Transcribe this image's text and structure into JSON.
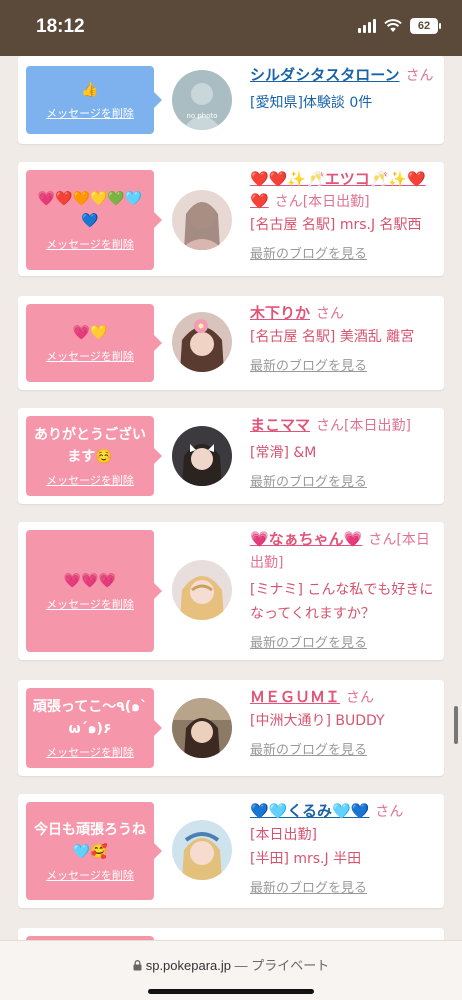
{
  "status_bar": {
    "time": "18:12",
    "battery": "62"
  },
  "browser": {
    "url": "sp.pokepara.jp",
    "separator": "—",
    "privacy": "プライベート"
  },
  "cards": [
    {
      "message": "👍",
      "delete_label": "メッセージを削除",
      "name": "シルダシタスタローン",
      "san": "さん",
      "meta": "[愛知県]体験談 0件",
      "avatar_note": "no photo",
      "theme": "blue"
    },
    {
      "message": "💗❤️🧡💛💚🩵💙",
      "delete_label": "メッセージを削除",
      "name": "❤️❤️✨🥂エツコ🥂✨❤️❤️",
      "san": "さん",
      "meta_tag": "[本日出勤]",
      "meta": "[名古屋 名駅] mrs.J 名駅西",
      "blog": "最新のブログを見る",
      "theme": "pink"
    },
    {
      "message": "💗💛",
      "delete_label": "メッセージを削除",
      "name": "木下りか",
      "san": "さん",
      "meta": "[名古屋 名駅] 美酒乱 離宮",
      "blog": "最新のブログを見る",
      "theme": "pink"
    },
    {
      "message": "ありがとうございます☺️",
      "delete_label": "メッセージを削除",
      "name": "まこママ",
      "san": "さん",
      "meta_tag": "[本日出勤]",
      "meta": "[常滑] &M",
      "blog": "最新のブログを見る",
      "theme": "pink"
    },
    {
      "message": "💗💗💗",
      "delete_label": "メッセージを削除",
      "name": "💗なぁちゃん💗",
      "san": "さん",
      "meta_tag": "[本日出勤]",
      "meta": "[ミナミ] こんな私でも好きになってくれますか？",
      "blog": "最新のブログを見る",
      "theme": "pink"
    },
    {
      "message": "頑張ってこ〜٩(๑`ω´๑)۶",
      "delete_label": "メッセージを削除",
      "name": "ＭＥＧＵＭＩ",
      "san": "さん",
      "meta": "[中洲大通り] BUDDY",
      "blog": "最新のブログを見る",
      "theme": "pink"
    },
    {
      "message": "今日も頑張ろうね🩵🥰",
      "delete_label": "メッセージを削除",
      "name": "💙🩵くるみ🩵💙",
      "san": "さん",
      "meta_tag": "[本日出勤]",
      "meta": "[半田] mrs.J 半田",
      "blog": "最新のブログを見る",
      "theme": "pink"
    }
  ]
}
